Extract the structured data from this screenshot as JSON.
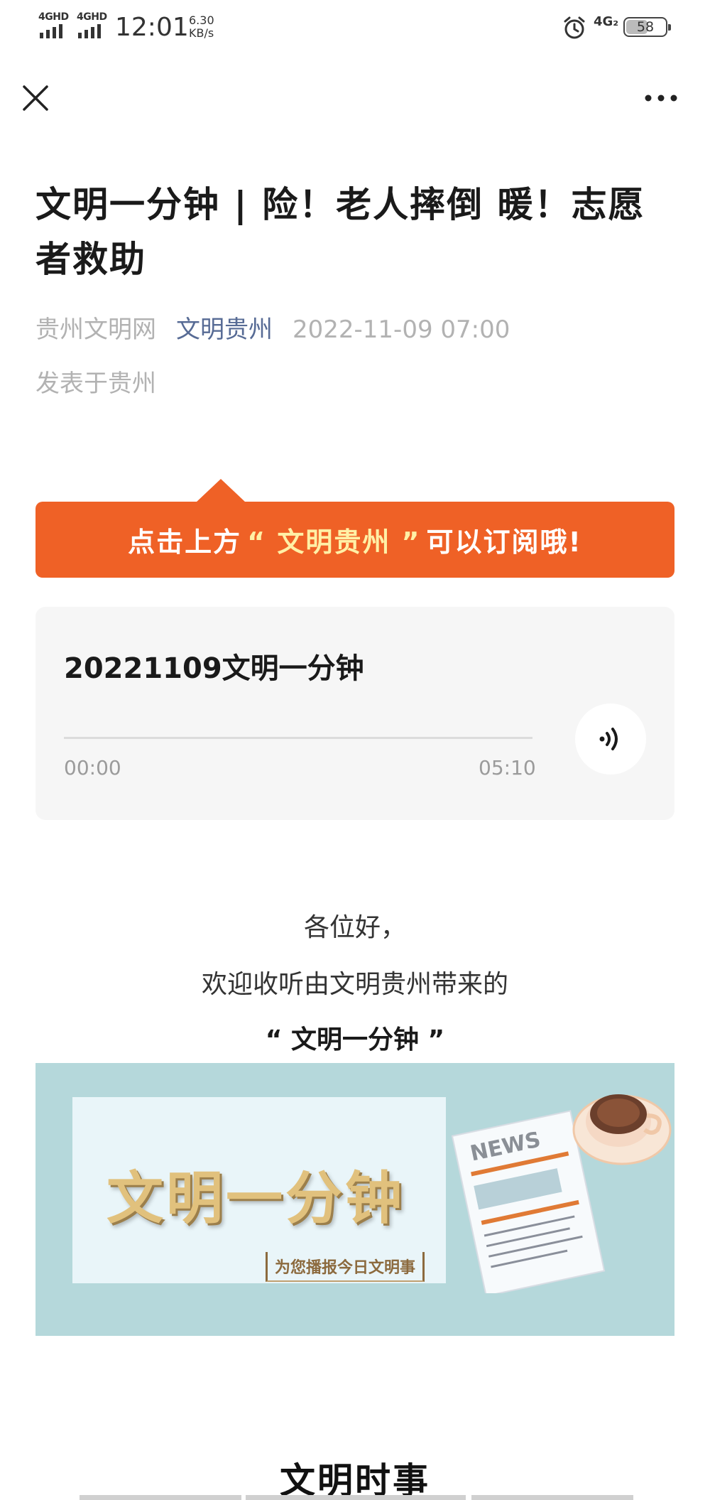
{
  "status_bar": {
    "signal1_label": "4GHD",
    "signal2_label": "4GHD",
    "time": "12:01",
    "speed_value": "6.30",
    "speed_unit": "KB/s",
    "network_label": "4G₂",
    "battery": "58",
    "icons": [
      "signal-icon",
      "alarm-icon",
      "battery-icon"
    ]
  },
  "nav": {
    "close_icon": "close-icon",
    "more_icon": "more-icon"
  },
  "article": {
    "title": "文明一分钟 | 险！老人摔倒 暖！志愿者救助",
    "author": "贵州文明网",
    "account": "文明贵州",
    "date": "2022-11-09 07:00",
    "location": "发表于贵州"
  },
  "banner": {
    "prefix": "点击上方",
    "highlight": "“ 文明贵州 ”",
    "suffix": "可以订阅哦!",
    "color": "#ef6126"
  },
  "audio": {
    "title": "20221109文明一分钟",
    "current_time": "00:00",
    "duration": "05:10",
    "progress": 0
  },
  "intro": {
    "line1": "各位好，",
    "line2": "欢迎收听由文明贵州带来的",
    "line3": "“ 文明一分钟 ”"
  },
  "cover": {
    "title": "文明一分钟",
    "subtitle": "为您播报今日文明事",
    "news_label": "NEWS",
    "background": "#b5d8db"
  },
  "section": {
    "title": "文明时事"
  }
}
